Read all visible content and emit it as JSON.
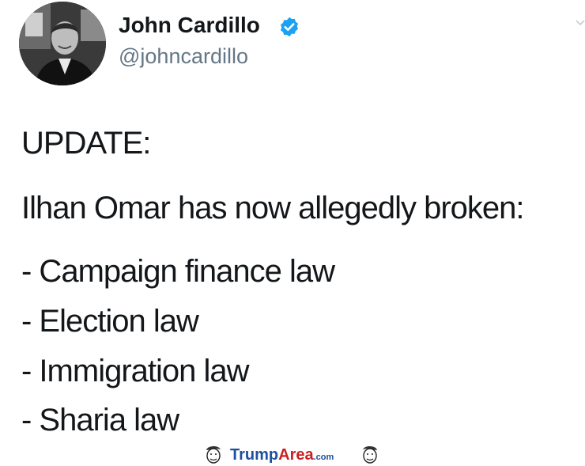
{
  "author": {
    "display_name": "John Cardillo",
    "handle": "@johncardillo",
    "verified": true,
    "avatar_icon": "person-avatar",
    "verified_icon": "verified-badge-icon"
  },
  "tweet": {
    "lines": [
      "UPDATE:",
      "Ilhan Omar has now allegedly broken:",
      "- Campaign finance law",
      "- Election law",
      "- Immigration law",
      "- Sharia law"
    ]
  },
  "watermark": {
    "part1": "Trump",
    "part2": "Area",
    "part3": ".com",
    "logo": "TrumpArea.com"
  },
  "colors": {
    "text": "#14171a",
    "handle": "#657786",
    "verified": "#1da1f2",
    "wm_blue": "#1f4f9f",
    "wm_red": "#cc2020"
  }
}
